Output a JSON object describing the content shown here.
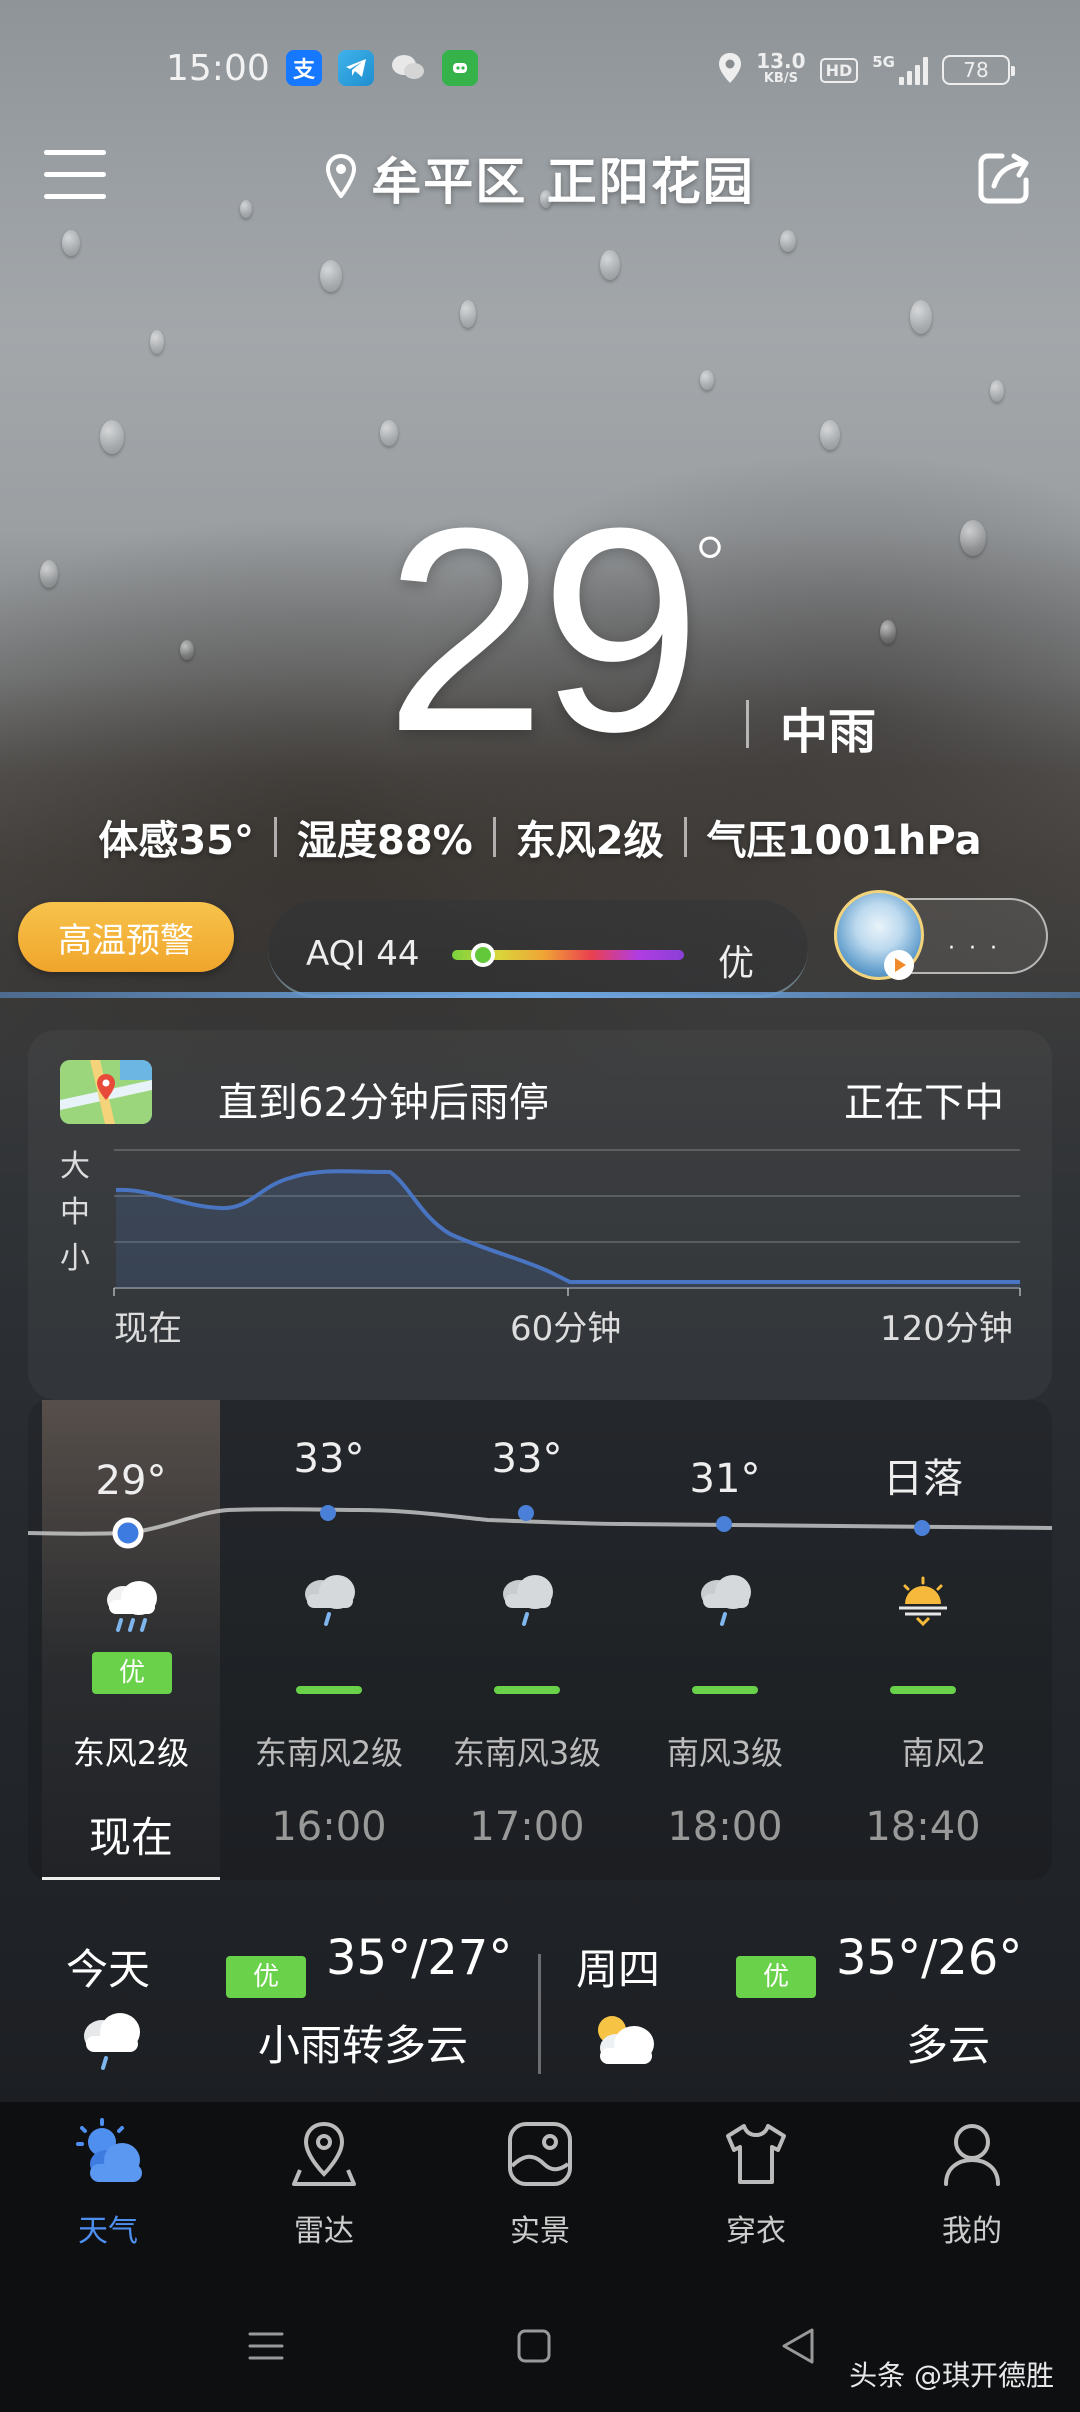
{
  "status_bar": {
    "time": "15:00",
    "app_icons": [
      "alipay-icon",
      "telegram-icon",
      "wechat-icon",
      "gamepad-icon"
    ],
    "net_speed_value": "13.0",
    "net_speed_unit": "KB/S",
    "hd": "HD",
    "signal": "5G",
    "battery": "78"
  },
  "header": {
    "location": "牟平区 正阳花园"
  },
  "current": {
    "temperature": "29",
    "degree": "°",
    "condition": "中雨",
    "details": [
      "体感35°",
      "湿度88%",
      "东风2级",
      "气压1001hPa"
    ]
  },
  "alerts": {
    "warning": "高温预警",
    "aqi_label": "AQI",
    "aqi_value": "44",
    "aqi_level": "优",
    "aqi_fraction": 0.09
  },
  "precipitation": {
    "title": "直到62分钟后雨停",
    "status": "正在下中",
    "y_labels": [
      "大",
      "中",
      "小"
    ],
    "x_labels": [
      "现在",
      "60分钟",
      "120分钟"
    ]
  },
  "hourly": [
    {
      "temp": "29°",
      "icon": "rain-cloud-icon",
      "aq": "优",
      "wind": "东风2级",
      "time": "现在"
    },
    {
      "temp": "33°",
      "icon": "cloud-rain-icon",
      "aq": "",
      "wind": "东南风2级",
      "time": "16:00"
    },
    {
      "temp": "33°",
      "icon": "cloud-rain-icon",
      "aq": "",
      "wind": "东南风3级",
      "time": "17:00"
    },
    {
      "temp": "31°",
      "icon": "cloud-rain-icon",
      "aq": "",
      "wind": "南风3级",
      "time": "18:00"
    },
    {
      "temp": "日落",
      "icon": "sunset-icon",
      "aq": "",
      "wind": "南风2",
      "time": "18:40"
    }
  ],
  "daily": [
    {
      "day": "今天",
      "aq": "优",
      "range": "35°/27°",
      "condition": "小雨转多云"
    },
    {
      "day": "周四",
      "aq": "优",
      "range": "35°/26°",
      "condition": "多云"
    }
  ],
  "nav": [
    {
      "label": "天气",
      "icon": "weather-icon"
    },
    {
      "label": "雷达",
      "icon": "radar-pin-icon"
    },
    {
      "label": "实景",
      "icon": "live-scene-icon"
    },
    {
      "label": "穿衣",
      "icon": "clothing-icon"
    },
    {
      "label": "我的",
      "icon": "profile-icon"
    }
  ],
  "watermark": "头条 @琪开德胜",
  "colors": {
    "accent_blue": "#4f8ff0",
    "aq_green": "#69d24a",
    "warning_orange": "#f0a52b"
  }
}
